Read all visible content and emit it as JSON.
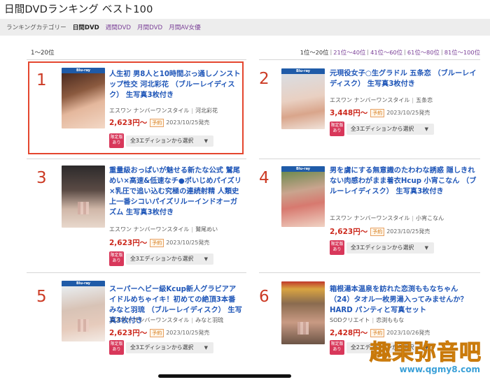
{
  "page_title": "日間DVDランキング ベスト100",
  "category_bar": {
    "label": "ランキングカテゴリー",
    "tabs": [
      {
        "label": "日間DVD",
        "active": true
      },
      {
        "label": "週間DVD",
        "active": false
      },
      {
        "label": "月間DVD",
        "active": false
      },
      {
        "label": "月間AV女優",
        "active": false
      }
    ]
  },
  "range_text": "1〜20位",
  "pager": {
    "current": "1位〜20位",
    "links": [
      "21位〜40位",
      "41位〜60位",
      "61位〜80位",
      "81位〜100位"
    ],
    "separator": "|"
  },
  "edition_select_label": "全3エディションから選択",
  "edition_select_label_2": "全2エディションから選択",
  "gentei_badge": "限定版\nあり",
  "yoyaku_badge": "予約",
  "colors": {
    "rank": "#cc3a24",
    "title_link": "#1f56b8",
    "price": "#cc2a1e",
    "highlight_border": "#e4462e",
    "gentei_badge": "#d8375a",
    "watermark": "#f3a21b"
  },
  "items": [
    {
      "rank": "1",
      "title": "人生初 男8人と10時間ぶっ通しノンストップ性交 河北彩花 （ブルーレイディスク） 生写真3枚付き",
      "maker": "エスワン ナンバーワンスタイル",
      "actress": "河北彩花",
      "price": "2,623円〜",
      "release": "2023/10/25発売"
    },
    {
      "rank": "2",
      "title": "元現役女子○生グラドル 五条恋 （ブルーレイディスク） 生写真3枚付き",
      "maker": "エスワン ナンバーワンスタイル",
      "actress": "五条恋",
      "price": "3,448円〜",
      "release": "2023/10/25発売"
    },
    {
      "rank": "3",
      "title": "重量級おっぱいが魅せる新たな公式 鷲尾めい×高速&低速なチ●ポいじめパイズリ×乳圧で追い込む究極の連続射精 人類史上一番シコいパイズリルーインドオーガズム 生写真3枚付き",
      "maker": "エスワン ナンバーワンスタイル",
      "actress": "鷲尾めい",
      "price": "2,623円〜",
      "release": "2023/10/25発売"
    },
    {
      "rank": "4",
      "title": "男を虜にする無意識のたわわな誘惑 隠しきれない肉感わがまま着衣Hcup 小宵こなん （ブルーレイディスク） 生写真3枚付き",
      "maker": "エスワン ナンバーワンスタイル",
      "actress": "小宵こなん",
      "price": "2,623円〜",
      "release": "2023/10/25発売"
    },
    {
      "rank": "5",
      "title": "スーパーヘビー級Kcup新人グラビアアイドルめちゃイキ！初めての絶頂3本番 みなと羽琉 （ブルーレイディスク） 生写真3枚付き",
      "maker": "エスワン ナンバーワンスタイル",
      "actress": "みなと羽琉",
      "price": "2,623円〜",
      "release": "2023/10/25発売"
    },
    {
      "rank": "6",
      "title": "箱根湯本温泉を訪れた恋渕ももなちゃん（24）タオル一枚男湯入ってみませんか？HARD パンティと写真セット",
      "maker": "SODクリエイト",
      "actress": "恋渕ももな",
      "price": "2,428円〜",
      "release": "2023/10/26発売"
    }
  ],
  "watermark": {
    "main": "趣果弥音吧",
    "sub": "www.qgmy8.com"
  }
}
